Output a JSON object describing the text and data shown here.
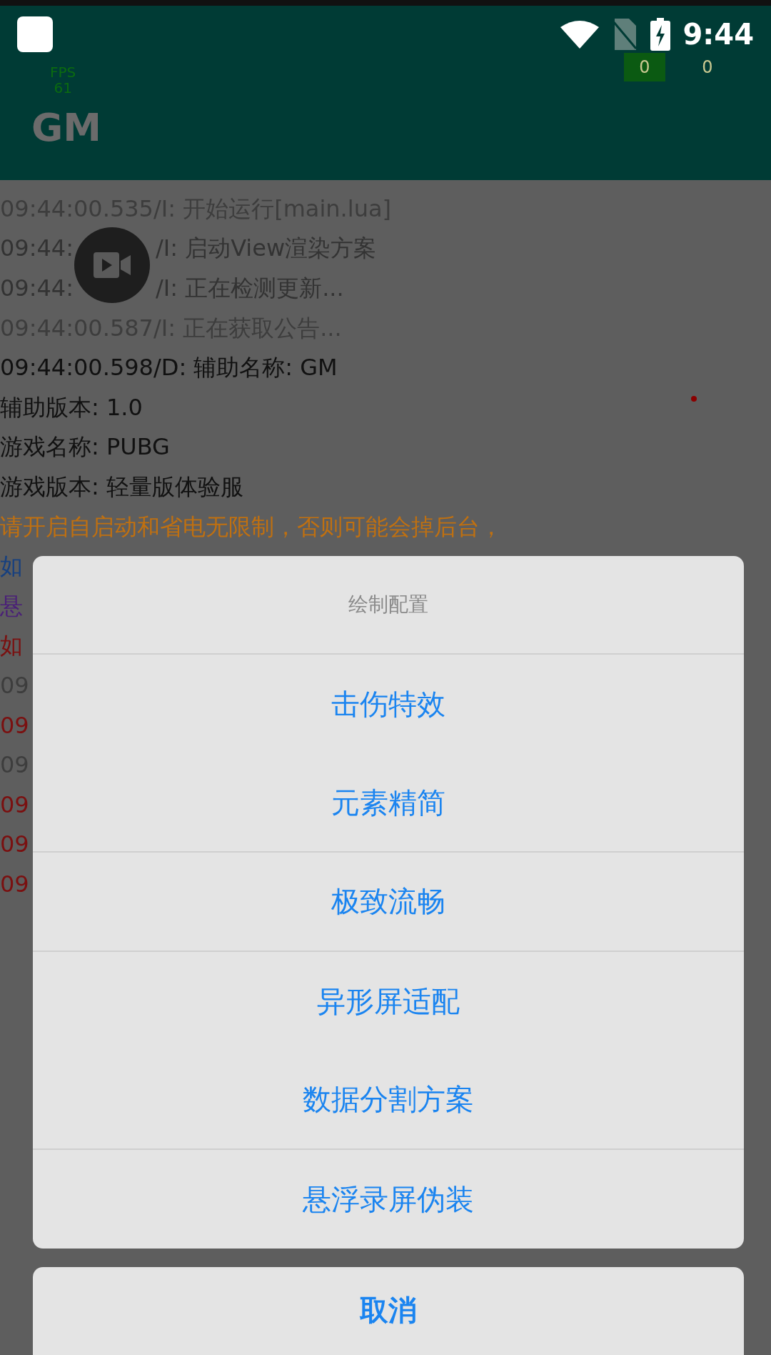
{
  "status_bar": {
    "time": "9:44"
  },
  "app_bar": {
    "fps_label": "FPS",
    "fps_value": "61",
    "title": "GM",
    "counters": [
      {
        "text": "0",
        "color": "#0b5a12"
      },
      {
        "text": "0",
        "color": "#003b35"
      }
    ]
  },
  "log": [
    {
      "parts": [
        "09:44:00.535/I: 开始运行[main.lua]"
      ],
      "color": "#3d3d3d"
    },
    {
      "parts": [
        "09:44:",
        "/I: 启动View渲染方案"
      ],
      "color": "#333333"
    },
    {
      "parts": [
        "09:44:",
        "/I: 正在检测更新..."
      ],
      "color": "#333333"
    },
    {
      "parts": [
        "09:44:00.587/I: 正在获取公告..."
      ],
      "color": "#3d3d3d"
    },
    {
      "parts": [
        "09:44:00.598/D: 辅助名称: GM"
      ],
      "color": "#111111"
    },
    {
      "parts": [
        "辅助版本: 1.0"
      ],
      "color": "#111111"
    },
    {
      "parts": [
        "游戏名称: PUBG"
      ],
      "color": "#111111"
    },
    {
      "parts": [
        "游戏版本: 轻量版体验服"
      ],
      "color": "#111111"
    },
    {
      "parts": [
        "请开启自启动和省电无限制，否则可能会掉后台，"
      ],
      "color": "#c07010"
    },
    {
      "parts": [
        "如"
      ],
      "color": "#17407f"
    },
    {
      "parts": [
        "悬"
      ],
      "color": "#4a1f78"
    },
    {
      "parts": [
        "如"
      ],
      "color": "#7a1010"
    },
    {
      "parts": [
        "09"
      ],
      "color": "#3d3d3d"
    },
    {
      "parts": [
        "09"
      ],
      "color": "#7a1010"
    },
    {
      "parts": [
        "09"
      ],
      "color": "#3d3d3d"
    },
    {
      "parts": [
        "09"
      ],
      "color": "#7a1010"
    },
    {
      "parts": [
        "09"
      ],
      "color": "#7a1010"
    },
    {
      "parts": [
        "09"
      ],
      "color": "#7a1010"
    }
  ],
  "dialog": {
    "title": "绘制配置",
    "items": [
      {
        "label": "击伤特效",
        "divider_after": false
      },
      {
        "label": "元素精简",
        "divider_after": true
      },
      {
        "label": "极致流畅",
        "divider_after": true
      },
      {
        "label": "异形屏适配",
        "divider_after": false
      },
      {
        "label": "数据分割方案",
        "divider_after": true
      },
      {
        "label": "悬浮录屏伪装",
        "divider_after": false
      }
    ],
    "cancel": "取消"
  }
}
